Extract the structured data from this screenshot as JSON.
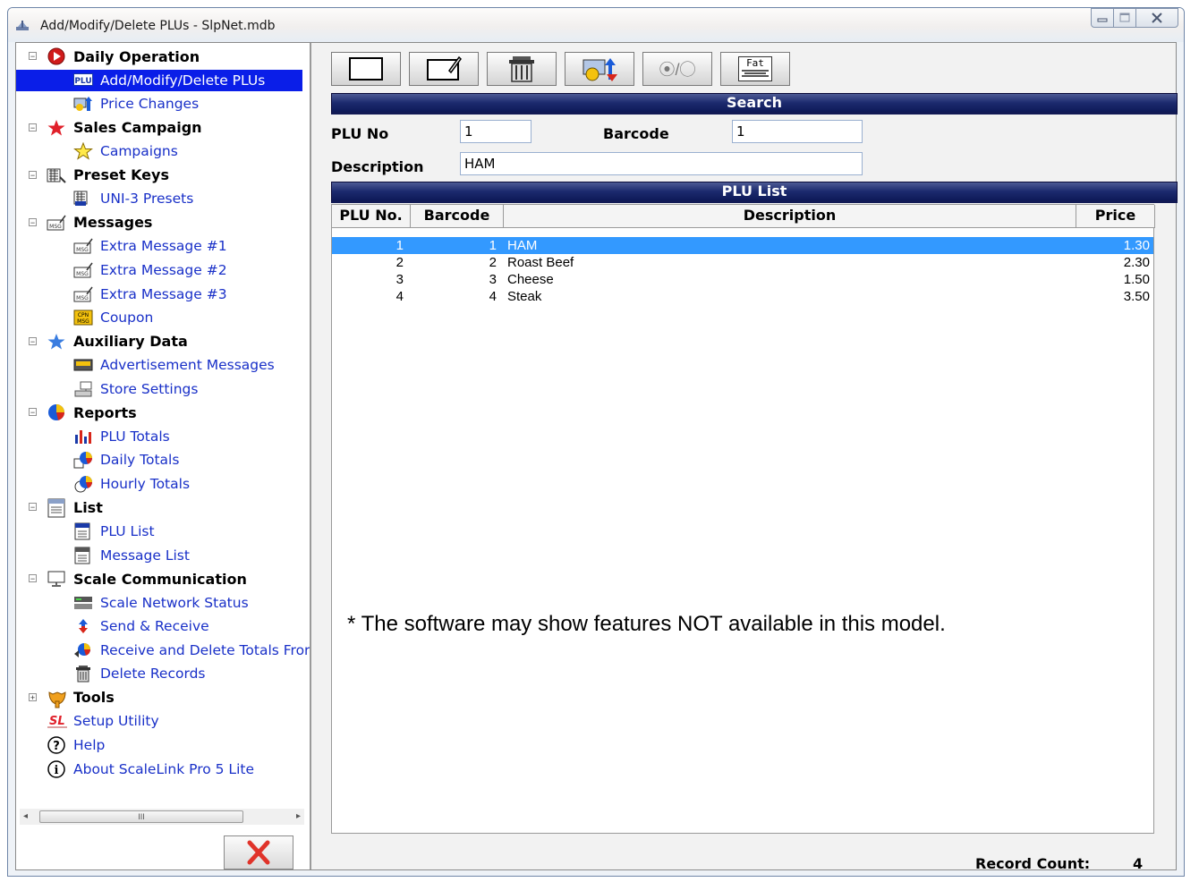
{
  "window": {
    "title": "Add/Modify/Delete PLUs - SlpNet.mdb"
  },
  "tree": [
    {
      "label": "Daily Operation",
      "type": "cat",
      "expander": "⊟",
      "icon": "play-icon"
    },
    {
      "label": "Add/Modify/Delete PLUs",
      "type": "item",
      "icon": "plu-icon",
      "selected": true
    },
    {
      "label": "Price Changes",
      "type": "item",
      "icon": "price-change-icon"
    },
    {
      "label": "Sales Campaign",
      "type": "cat",
      "expander": "⊟",
      "icon": "red-star-icon"
    },
    {
      "label": "Campaigns",
      "type": "item",
      "icon": "yellow-star-icon"
    },
    {
      "label": "Preset Keys",
      "type": "cat",
      "expander": "⊟",
      "icon": "preset-keys-icon"
    },
    {
      "label": "UNI-3 Presets",
      "type": "item",
      "icon": "uni3-presets-icon"
    },
    {
      "label": "Messages",
      "type": "cat",
      "expander": "⊟",
      "icon": "message-icon"
    },
    {
      "label": "Extra Message #1",
      "type": "item",
      "icon": "message-icon"
    },
    {
      "label": "Extra Message #2",
      "type": "item",
      "icon": "message-icon"
    },
    {
      "label": "Extra Message #3",
      "type": "item",
      "icon": "message-icon"
    },
    {
      "label": "Coupon",
      "type": "item",
      "icon": "coupon-icon"
    },
    {
      "label": "Auxiliary Data",
      "type": "cat",
      "expander": "⊟",
      "icon": "blue-star-icon"
    },
    {
      "label": "Advertisement Messages",
      "type": "item",
      "icon": "advertisement-icon"
    },
    {
      "label": "Store Settings",
      "type": "item",
      "icon": "store-settings-icon"
    },
    {
      "label": "Reports",
      "type": "cat",
      "expander": "⊟",
      "icon": "pie-chart-icon"
    },
    {
      "label": "PLU Totals",
      "type": "item",
      "icon": "bar-chart-icon"
    },
    {
      "label": "Daily Totals",
      "type": "item",
      "icon": "daily-totals-icon"
    },
    {
      "label": "Hourly Totals",
      "type": "item",
      "icon": "hourly-totals-icon"
    },
    {
      "label": "List",
      "type": "cat",
      "expander": "⊟",
      "icon": "list-icon"
    },
    {
      "label": "PLU List",
      "type": "item",
      "icon": "plu-list-icon"
    },
    {
      "label": "Message List",
      "type": "item",
      "icon": "message-list-icon"
    },
    {
      "label": "Scale Communication",
      "type": "cat",
      "expander": "⊟",
      "icon": "monitor-icon"
    },
    {
      "label": "Scale Network Status",
      "type": "item",
      "icon": "network-status-icon"
    },
    {
      "label": "Send & Receive",
      "type": "item",
      "icon": "send-receive-icon"
    },
    {
      "label": "Receive and Delete Totals Fror",
      "type": "item",
      "icon": "receive-delete-icon"
    },
    {
      "label": "Delete Records",
      "type": "item",
      "icon": "trash-icon"
    },
    {
      "label": "Tools",
      "type": "cat",
      "expander": "⊞",
      "icon": "wrench-icon"
    },
    {
      "label": "Setup Utility",
      "type": "item",
      "icon": "setup-utility-icon",
      "root": true
    },
    {
      "label": "Help",
      "type": "item",
      "icon": "help-icon",
      "root": true
    },
    {
      "label": "About ScaleLink Pro 5 Lite",
      "type": "item",
      "icon": "info-icon",
      "root": true
    }
  ],
  "scrollbar": {
    "grip": "III"
  },
  "search": {
    "title": "Search",
    "plu_label": "PLU No",
    "plu_value": "1",
    "barcode_label": "Barcode",
    "barcode_value": "1",
    "description_label": "Description",
    "description_value": "HAM"
  },
  "toolbar": {
    "toggle_label": "⦿/◯",
    "nutrition_label": "Fat"
  },
  "plu_list": {
    "title": "PLU List",
    "columns": [
      "PLU No.",
      "Barcode",
      "Description",
      "Price"
    ],
    "rows": [
      {
        "plu": "1",
        "barcode": "1",
        "description": "HAM",
        "price": "1.30",
        "selected": true
      },
      {
        "plu": "2",
        "barcode": "2",
        "description": "Roast Beef",
        "price": "2.30"
      },
      {
        "plu": "3",
        "barcode": "3",
        "description": "Cheese",
        "price": "1.50"
      },
      {
        "plu": "4",
        "barcode": "4",
        "description": "Steak",
        "price": "3.50"
      }
    ]
  },
  "note": "* The software may show features NOT available in this model.",
  "record_count": {
    "label": "Record Count:",
    "value": "4"
  },
  "colors": {
    "selection": "#0a1ee8",
    "row_selection": "#3399ff",
    "link": "#1930c8",
    "section_bar": "#1c2a6e",
    "close_x": "#e0332a"
  }
}
